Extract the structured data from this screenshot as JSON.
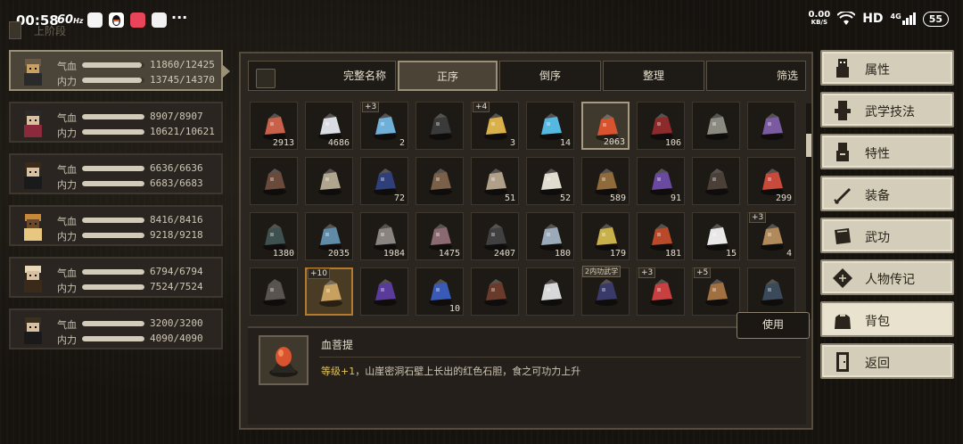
{
  "status_bar": {
    "time": "00:58",
    "refresh": "60",
    "net_speed_value": "0.00",
    "net_speed_unit": "KB/S",
    "hd": "HD",
    "signal": "4G",
    "battery": "55",
    "more": "···"
  },
  "behind_label": "上阶段",
  "party": [
    {
      "hp_label": "气血",
      "hp": "11860/12425",
      "hp_frac": 0.954,
      "mp_label": "内力",
      "mp": "13745/14370",
      "mp_frac": 0.956
    },
    {
      "hp_label": "气血",
      "hp": "8907/8907",
      "hp_frac": 1.0,
      "mp_label": "内力",
      "mp": "10621/10621",
      "mp_frac": 1.0
    },
    {
      "hp_label": "气血",
      "hp": "6636/6636",
      "hp_frac": 1.0,
      "mp_label": "内力",
      "mp": "6683/6683",
      "mp_frac": 1.0
    },
    {
      "hp_label": "气血",
      "hp": "8416/8416",
      "hp_frac": 1.0,
      "mp_label": "内力",
      "mp": "9218/9218",
      "mp_frac": 1.0
    },
    {
      "hp_label": "气血",
      "hp": "6794/6794",
      "hp_frac": 1.0,
      "mp_label": "内力",
      "mp": "7524/7524",
      "mp_frac": 1.0
    },
    {
      "hp_label": "气血",
      "hp": "3200/3200",
      "hp_frac": 1.0,
      "mp_label": "内力",
      "mp": "4090/4090",
      "mp_frac": 1.0
    }
  ],
  "sort_bar": {
    "full_name": "完整名称",
    "asc": "正序",
    "desc": "倒序",
    "organize": "整理",
    "filter": "筛选"
  },
  "items": [
    {
      "count": "2913",
      "icon": "red-ore",
      "color": "#c8604a"
    },
    {
      "count": "4686",
      "icon": "white-powder",
      "color": "#d9dde3"
    },
    {
      "count": "2",
      "plus": "+3",
      "icon": "spirit-gourd",
      "color": "#6fb0d8"
    },
    {
      "count": "",
      "icon": "black-bowl",
      "color": "#3a3a3a"
    },
    {
      "count": "3",
      "plus": "+4",
      "icon": "golden-armor",
      "color": "#d9b04a"
    },
    {
      "count": "14",
      "icon": "blue-orb-stand",
      "color": "#55b8e0"
    },
    {
      "count": "2063",
      "icon": "blood-bodhi",
      "color": "#d8532e",
      "selected": true
    },
    {
      "count": "106",
      "icon": "red-lantern",
      "color": "#8f2a2a"
    },
    {
      "count": "",
      "icon": "stone-shrine",
      "color": "#8a8a80"
    },
    {
      "count": "",
      "icon": "purple-robe",
      "color": "#7a5aa0"
    },
    {
      "count": "",
      "icon": "old-map",
      "color": "#6a4a3a"
    },
    {
      "count": "",
      "icon": "dagger",
      "color": "#b0a68f"
    },
    {
      "count": "72",
      "icon": "blue-vase",
      "color": "#2e3f7a"
    },
    {
      "count": "",
      "icon": "tattered-cloth",
      "color": "#7a6048"
    },
    {
      "count": "51",
      "icon": "bowl-chopsticks",
      "color": "#b0a08a"
    },
    {
      "count": "52",
      "icon": "teapot",
      "color": "#e0dcd0"
    },
    {
      "count": "589",
      "icon": "bronze-coin",
      "color": "#8f6a3a"
    },
    {
      "count": "91",
      "icon": "purple-claw",
      "color": "#6a4aa0"
    },
    {
      "count": "",
      "icon": "iron-bars",
      "color": "#4a4038"
    },
    {
      "count": "299",
      "icon": "red-spear",
      "color": "#c84a3a"
    },
    {
      "count": "1380",
      "icon": "dark-ore",
      "color": "#3e5050"
    },
    {
      "count": "2035",
      "icon": "blue-crystal",
      "color": "#5f8aa8"
    },
    {
      "count": "1984",
      "icon": "gray-rock",
      "color": "#8a8480"
    },
    {
      "count": "1475",
      "icon": "pink-rock",
      "color": "#8a6a70"
    },
    {
      "count": "2407",
      "icon": "black-stone",
      "color": "#404040"
    },
    {
      "count": "180",
      "icon": "silver-cup",
      "color": "#9aaab8"
    },
    {
      "count": "179",
      "icon": "gold-cup",
      "color": "#c8b04a"
    },
    {
      "count": "181",
      "icon": "red-jar",
      "color": "#b84a2a"
    },
    {
      "count": "15",
      "icon": "pearl-stand",
      "color": "#e8e8e8"
    },
    {
      "count": "4",
      "plus": "+3",
      "icon": "straw-sandal",
      "color": "#b08a5a"
    },
    {
      "count": "",
      "icon": "cloth-vest",
      "color": "#5a5450"
    },
    {
      "count": "",
      "plus": "+10",
      "icon": "ornate-armor",
      "color": "#c8a060",
      "orange": true
    },
    {
      "count": "",
      "icon": "mystery-book",
      "color": "#5a3a9a"
    },
    {
      "count": "10",
      "icon": "blue-gem-stand",
      "color": "#3a5ab8"
    },
    {
      "count": "",
      "icon": "bundle-sticks",
      "color": "#6a3a2a"
    },
    {
      "count": "",
      "icon": "long-sword",
      "color": "#d8d8d8"
    },
    {
      "count": "",
      "tag": "2内功武学",
      "icon": "martial-manual",
      "color": "#3a3a6a"
    },
    {
      "count": "",
      "plus": "+3",
      "icon": "red-blade",
      "color": "#c84040"
    },
    {
      "count": "",
      "plus": "+5",
      "icon": "brazier",
      "color": "#a07040"
    },
    {
      "count": "",
      "icon": "cage",
      "color": "#3a4a5a"
    }
  ],
  "use_label": "使用",
  "detail": {
    "name": "血菩提",
    "level": "等级+1",
    "desc": "，山崖密洞石壁上长出的红色石胆，食之可功力上升"
  },
  "menu": [
    {
      "label": "属性",
      "icon": "character-icon"
    },
    {
      "label": "武学技法",
      "icon": "martial-skills-icon"
    },
    {
      "label": "特性",
      "icon": "traits-icon"
    },
    {
      "label": "装备",
      "icon": "sword-icon"
    },
    {
      "label": "武功",
      "icon": "book-icon"
    },
    {
      "label": "人物传记",
      "icon": "biography-icon"
    },
    {
      "label": "背包",
      "icon": "bag-icon",
      "active": true
    },
    {
      "label": "返回",
      "icon": "door-icon"
    }
  ],
  "colors": {
    "accent": "#9a8f77",
    "panel": "#2b2620",
    "highlight": "#e2c35a",
    "menu_bg": "#d3cdb9"
  }
}
